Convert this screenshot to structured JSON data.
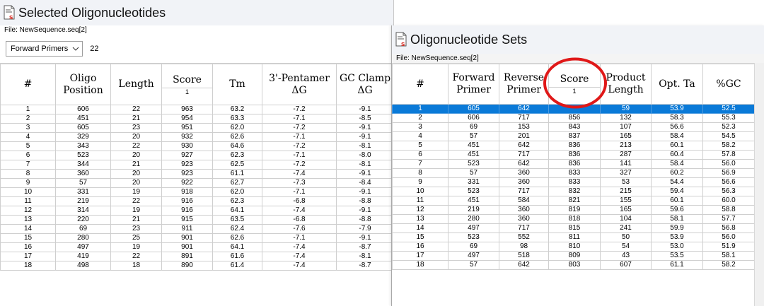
{
  "left_window": {
    "title": "Selected Oligonucleotides",
    "file_label": "File: NewSequence.seq[2]",
    "dropdown": {
      "value": "Forward Primers",
      "count": "22"
    },
    "columns": [
      {
        "label": "#",
        "sort": ""
      },
      {
        "label": "Oligo Position",
        "sort": ""
      },
      {
        "label": "Length",
        "sort": ""
      },
      {
        "label": "Score",
        "sort": "1"
      },
      {
        "label": "Tm",
        "sort": ""
      },
      {
        "label": "3'-Pentamer ΔG",
        "sort": ""
      },
      {
        "label": "GC Clamp ΔG",
        "sort": ""
      }
    ],
    "rows": [
      [
        "1",
        "606",
        "22",
        "963",
        "63.2",
        "-7.2",
        "-9.1"
      ],
      [
        "2",
        "451",
        "21",
        "954",
        "63.3",
        "-7.1",
        "-8.5"
      ],
      [
        "3",
        "605",
        "23",
        "951",
        "62.0",
        "-7.2",
        "-9.1"
      ],
      [
        "4",
        "329",
        "20",
        "932",
        "62.6",
        "-7.1",
        "-9.1"
      ],
      [
        "5",
        "343",
        "22",
        "930",
        "64.6",
        "-7.2",
        "-8.1"
      ],
      [
        "6",
        "523",
        "20",
        "927",
        "62.3",
        "-7.1",
        "-8.0"
      ],
      [
        "7",
        "344",
        "21",
        "923",
        "62.5",
        "-7.2",
        "-8.1"
      ],
      [
        "8",
        "360",
        "20",
        "923",
        "61.1",
        "-7.4",
        "-9.1"
      ],
      [
        "9",
        "57",
        "20",
        "922",
        "62.7",
        "-7.3",
        "-8.4"
      ],
      [
        "10",
        "331",
        "19",
        "918",
        "62.0",
        "-7.1",
        "-9.1"
      ],
      [
        "11",
        "219",
        "22",
        "916",
        "62.3",
        "-6.8",
        "-8.8"
      ],
      [
        "12",
        "314",
        "19",
        "916",
        "64.1",
        "-7.4",
        "-9.1"
      ],
      [
        "13",
        "220",
        "21",
        "915",
        "63.5",
        "-6.8",
        "-8.8"
      ],
      [
        "14",
        "69",
        "23",
        "911",
        "62.4",
        "-7.6",
        "-7.9"
      ],
      [
        "15",
        "280",
        "25",
        "901",
        "62.6",
        "-7.1",
        "-9.1"
      ],
      [
        "16",
        "497",
        "19",
        "901",
        "64.1",
        "-7.4",
        "-8.7"
      ],
      [
        "17",
        "419",
        "22",
        "891",
        "61.6",
        "-7.4",
        "-8.1"
      ],
      [
        "18",
        "498",
        "18",
        "890",
        "61.4",
        "-7.4",
        "-8.7"
      ]
    ]
  },
  "right_window": {
    "title": "Oligonucleotide Sets",
    "file_label": "File: NewSequence.seq[2]",
    "columns": [
      {
        "label": "#",
        "sort": ""
      },
      {
        "label": "Forward Primer",
        "sort": ""
      },
      {
        "label": "Reverse Primer",
        "sort": ""
      },
      {
        "label": "Score",
        "sort": "1"
      },
      {
        "label": "Product Length",
        "sort": ""
      },
      {
        "label": "Opt. Ta",
        "sort": ""
      },
      {
        "label": "%GC",
        "sort": ""
      }
    ],
    "selected_row": 0,
    "rows": [
      [
        "1",
        "605",
        "642",
        "",
        "59",
        "53.9",
        "52.5"
      ],
      [
        "2",
        "606",
        "717",
        "856",
        "132",
        "58.3",
        "55.3"
      ],
      [
        "3",
        "69",
        "153",
        "843",
        "107",
        "56.6",
        "52.3"
      ],
      [
        "4",
        "57",
        "201",
        "837",
        "165",
        "58.4",
        "54.5"
      ],
      [
        "5",
        "451",
        "642",
        "836",
        "213",
        "60.1",
        "58.2"
      ],
      [
        "6",
        "451",
        "717",
        "836",
        "287",
        "60.4",
        "57.8"
      ],
      [
        "7",
        "523",
        "642",
        "836",
        "141",
        "58.4",
        "56.0"
      ],
      [
        "8",
        "57",
        "360",
        "833",
        "327",
        "60.2",
        "56.9"
      ],
      [
        "9",
        "331",
        "360",
        "833",
        "53",
        "54.4",
        "56.6"
      ],
      [
        "10",
        "523",
        "717",
        "832",
        "215",
        "59.4",
        "56.3"
      ],
      [
        "11",
        "451",
        "584",
        "821",
        "155",
        "60.1",
        "60.0"
      ],
      [
        "12",
        "219",
        "360",
        "819",
        "165",
        "59.6",
        "58.8"
      ],
      [
        "13",
        "280",
        "360",
        "818",
        "104",
        "58.1",
        "57.7"
      ],
      [
        "14",
        "497",
        "717",
        "815",
        "241",
        "59.9",
        "56.8"
      ],
      [
        "15",
        "523",
        "552",
        "811",
        "50",
        "53.9",
        "56.0"
      ],
      [
        "16",
        "69",
        "98",
        "810",
        "54",
        "53.0",
        "51.9"
      ],
      [
        "17",
        "497",
        "518",
        "809",
        "43",
        "53.5",
        "58.1"
      ],
      [
        "18",
        "57",
        "642",
        "803",
        "607",
        "61.1",
        "58.2"
      ]
    ]
  },
  "colors": {
    "selection": "#0a7ad8",
    "annotation_circle": "#e01818",
    "doc_icon_red": "#d6281f"
  }
}
